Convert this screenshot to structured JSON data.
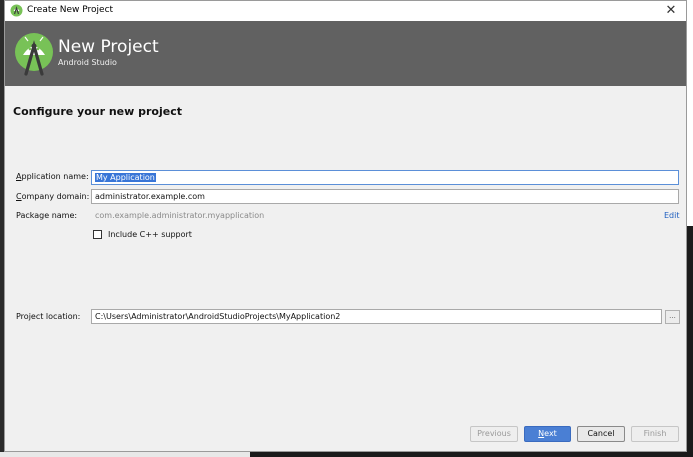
{
  "window": {
    "title": "Create New Project",
    "close_glyph": "✕",
    "app_icon": "android-studio-icon"
  },
  "header": {
    "title": "New Project",
    "subtitle": "Android Studio",
    "logo": "android-studio-logo",
    "background_color": "#616161"
  },
  "section": {
    "title": "Configure your new project"
  },
  "form": {
    "application_name": {
      "label_mnemonic": "A",
      "label_rest": "pplication name:",
      "value": "My Application"
    },
    "company_domain": {
      "label_mnemonic": "C",
      "label_rest": "ompany domain:",
      "value": "administrator.example.com"
    },
    "package_name": {
      "label": "Package name:",
      "value": "com.example.administrator.myapplication",
      "edit_label": "Edit"
    },
    "include_cpp": {
      "label": "Include C++ support",
      "checked": false
    },
    "project_location": {
      "label": "Project location:",
      "value": "C:\\Users\\Administrator\\AndroidStudioProjects\\MyApplication2",
      "browse_label": "..."
    }
  },
  "buttons": {
    "previous": "Previous",
    "next_mnemonic": "N",
    "next_rest": "ext",
    "cancel": "Cancel",
    "finish": "Finish"
  },
  "colors": {
    "accent": "#4a7fd4",
    "link": "#2060c0",
    "selection": "#3875d7"
  }
}
